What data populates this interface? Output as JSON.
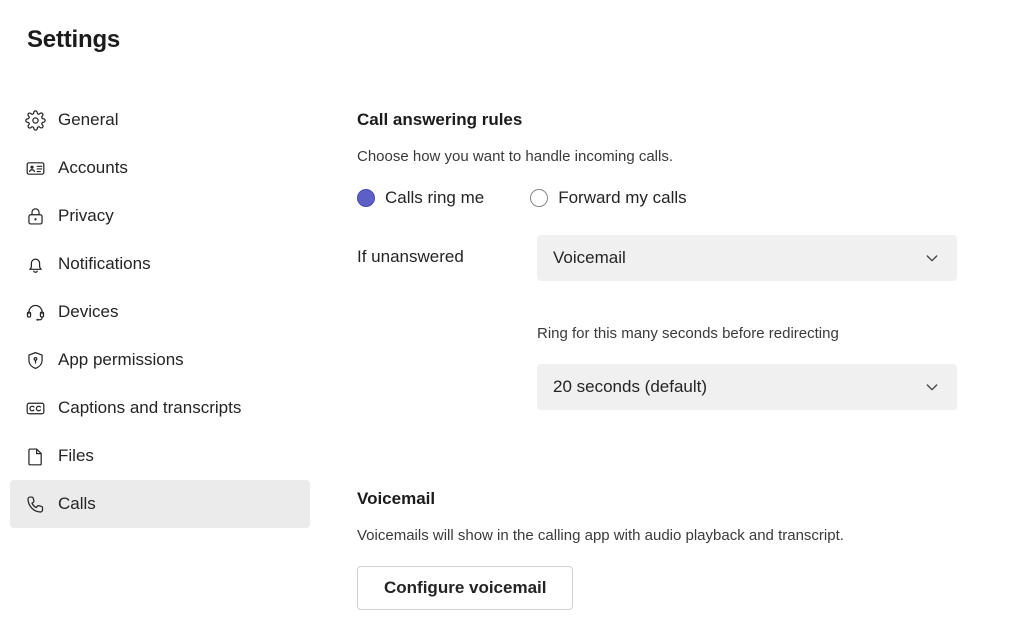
{
  "page": {
    "title": "Settings"
  },
  "sidebar": {
    "items": [
      {
        "label": "General",
        "icon": "gear-icon",
        "selected": false
      },
      {
        "label": "Accounts",
        "icon": "contact-card-icon",
        "selected": false
      },
      {
        "label": "Privacy",
        "icon": "lock-icon",
        "selected": false
      },
      {
        "label": "Notifications",
        "icon": "bell-icon",
        "selected": false
      },
      {
        "label": "Devices",
        "icon": "headset-icon",
        "selected": false
      },
      {
        "label": "App permissions",
        "icon": "shield-key-icon",
        "selected": false
      },
      {
        "label": "Captions and transcripts",
        "icon": "closed-caption-icon",
        "selected": false
      },
      {
        "label": "Files",
        "icon": "document-icon",
        "selected": false
      },
      {
        "label": "Calls",
        "icon": "phone-icon",
        "selected": true
      }
    ]
  },
  "main": {
    "call_answering_rules": {
      "heading": "Call answering rules",
      "description": "Choose how you want to handle incoming calls.",
      "radio_options": [
        {
          "label": "Calls ring me",
          "selected": true
        },
        {
          "label": "Forward my calls",
          "selected": false
        }
      ],
      "if_unanswered_label": "If unanswered",
      "if_unanswered_value": "Voicemail",
      "ring_duration_label": "Ring for this many seconds before redirecting",
      "ring_duration_value": "20 seconds (default)"
    },
    "voicemail": {
      "heading": "Voicemail",
      "description": "Voicemails will show in the calling app with audio playback and transcript.",
      "configure_button": "Configure voicemail"
    }
  },
  "colors": {
    "accent": "#5b5fc7",
    "selected_nav_bg": "#ebebeb",
    "dropdown_bg": "#f0f0f0",
    "text_primary": "#242424",
    "text_secondary": "#3b3a39"
  }
}
